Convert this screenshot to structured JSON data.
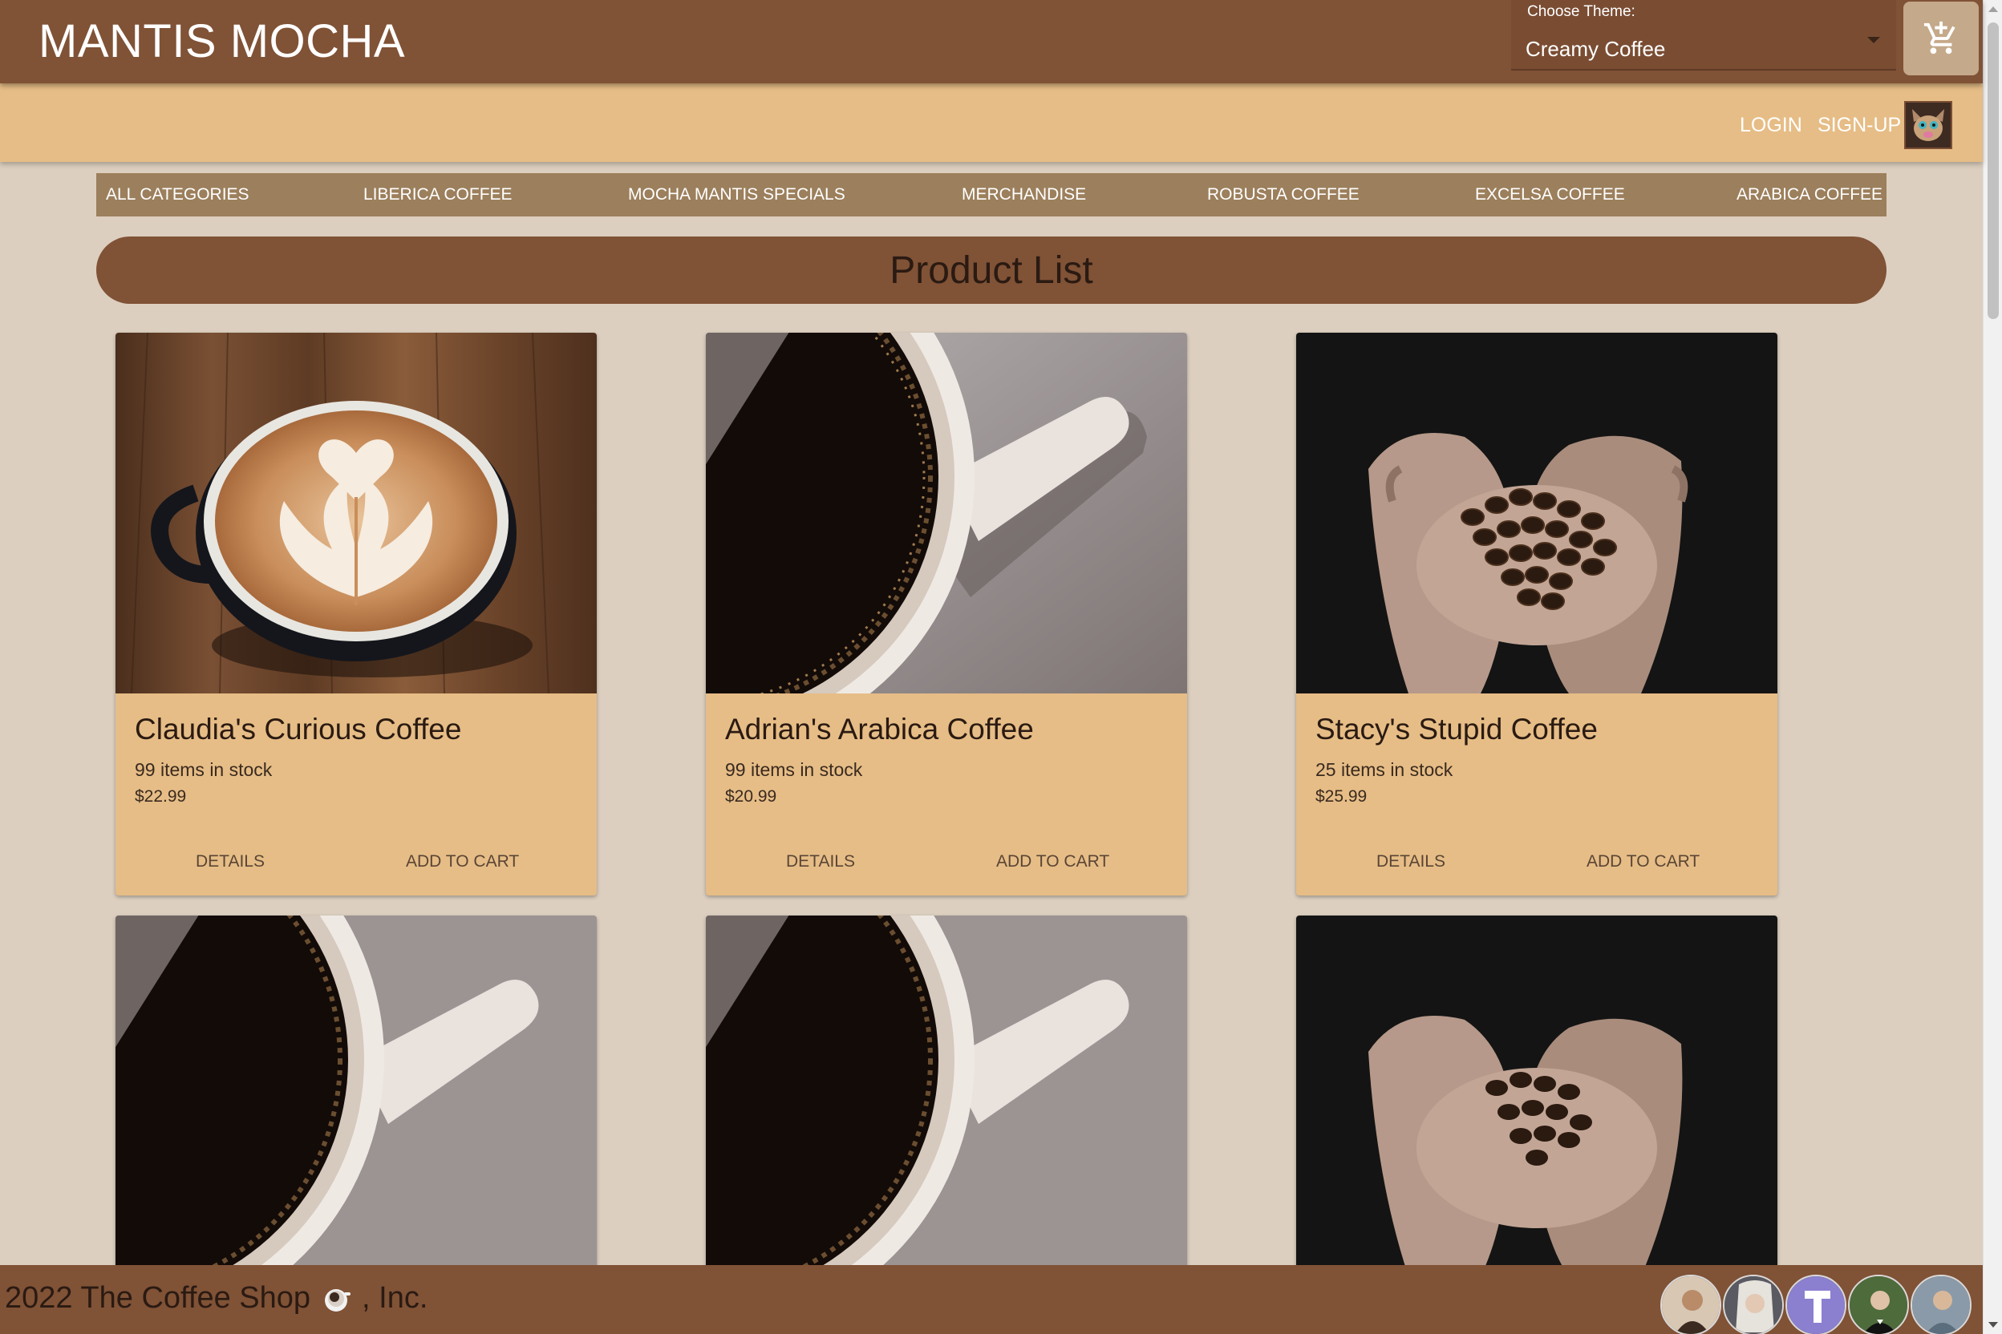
{
  "header": {
    "brand": "MANTIS MOCHA",
    "theme_label": "Choose Theme:",
    "theme_value": "Creamy Coffee",
    "cart_icon": "add-shopping-cart-icon"
  },
  "subnav": {
    "login": "LOGIN",
    "signup": "SIGN-UP",
    "avatar_icon": "cat-avatar"
  },
  "categories": [
    "ALL CATEGORIES",
    "LIBERICA COFFEE",
    "MOCHA MANTIS SPECIALS",
    "MERCHANDISE",
    "ROBUSTA COFFEE",
    "EXCELSA COFFEE",
    "ARABICA COFFEE"
  ],
  "product_list": {
    "title": "Product List",
    "details_label": "DETAILS",
    "add_to_cart_label": "ADD TO CART",
    "products": [
      {
        "name": "Claudia's Curious Coffee",
        "stock": "99 items in stock",
        "price": "$22.99",
        "image": "latte-art"
      },
      {
        "name": "Adrian's Arabica Coffee",
        "stock": "99 items in stock",
        "price": "$20.99",
        "image": "black-coffee-cup"
      },
      {
        "name": "Stacy's Stupid Coffee",
        "stock": "25 items in stock",
        "price": "$25.99",
        "image": "coffee-beans-in-hands"
      },
      {
        "image": "black-coffee-cup"
      },
      {
        "image": "black-coffee-cup"
      },
      {
        "image": "coffee-beans-in-hands"
      }
    ]
  },
  "footer": {
    "text_before": "2022 The Coffee Shop",
    "text_after": ", Inc."
  },
  "colors": {
    "topbar": "#805236",
    "subbar": "#e6bd86",
    "page_bg": "#dccfbf",
    "category_bar": "#9c7f5c",
    "card": "#e6bd86"
  }
}
